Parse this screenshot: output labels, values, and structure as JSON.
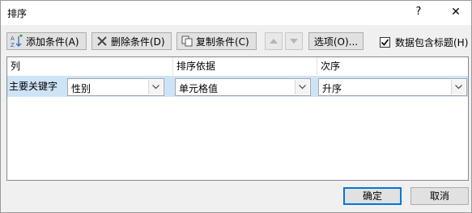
{
  "window": {
    "title": "排序",
    "help_glyph": "?",
    "close_glyph": "✕"
  },
  "toolbar": {
    "add_label": "添加条件(A)",
    "delete_label": "删除条件(D)",
    "copy_label": "复制条件(C)",
    "options_label": "选项(O)...",
    "header_checkbox_label": "数据包含标题(H)",
    "header_checkbox_checked": true
  },
  "grid": {
    "columns": [
      "列",
      "排序依据",
      "次序"
    ],
    "rows": [
      {
        "label": "主要关键字",
        "column": "性别",
        "sort_on": "单元格值",
        "order": "升序"
      }
    ]
  },
  "footer": {
    "ok_label": "确定",
    "cancel_label": "取消"
  }
}
